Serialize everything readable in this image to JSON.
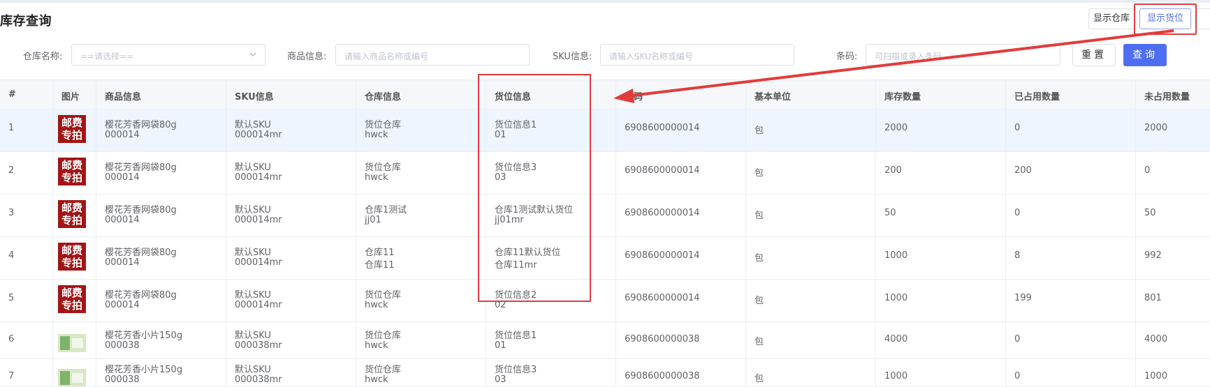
{
  "page": {
    "title": "库存查询"
  },
  "toolbar": {
    "show_warehouse": "显示仓库",
    "show_location": "显示货位",
    "edge_label": ""
  },
  "filters": {
    "warehouse": {
      "label": "仓库名称:",
      "placeholder": "==请选择=="
    },
    "product": {
      "label": "商品信息:",
      "placeholder": "请输入商品名称或编号"
    },
    "sku": {
      "label": "SKU信息:",
      "placeholder": "请输入SKU名称或编号"
    },
    "barcode": {
      "label": "条码:",
      "placeholder": "可扫描或录入条码"
    },
    "reset": "重置",
    "query": "查询"
  },
  "table": {
    "headers": [
      "#",
      "图片",
      "商品信息",
      "SKU信息",
      "仓库信息",
      "货位信息",
      "条码",
      "基本单位",
      "库存数量",
      "已占用数量",
      "未占用数量"
    ],
    "rows": [
      {
        "no": "1",
        "img": "邮费专拍",
        "product": "樱花芳香网袋80g",
        "product_code": "000014",
        "sku": "默认SKU",
        "sku_code": "000014mr",
        "wh": "货位仓库",
        "wh_code": "hwck",
        "loc": "货位信息1",
        "loc_code": "01",
        "barcode": "6908600000014",
        "unit": "包",
        "stock": "2000",
        "used": "0",
        "free": "2000"
      },
      {
        "no": "2",
        "img": "邮费专拍",
        "product": "樱花芳香网袋80g",
        "product_code": "000014",
        "sku": "默认SKU",
        "sku_code": "000014mr",
        "wh": "货位仓库",
        "wh_code": "hwck",
        "loc": "货位信息3",
        "loc_code": "03",
        "barcode": "6908600000014",
        "unit": "包",
        "stock": "200",
        "used": "200",
        "free": "0"
      },
      {
        "no": "3",
        "img": "邮费专拍",
        "product": "樱花芳香网袋80g",
        "product_code": "000014",
        "sku": "默认SKU",
        "sku_code": "000014mr",
        "wh": "仓库1测试",
        "wh_code": "jj01",
        "loc": "仓库1测试默认货位",
        "loc_code": "jj01mr",
        "barcode": "6908600000014",
        "unit": "包",
        "stock": "50",
        "used": "0",
        "free": "50"
      },
      {
        "no": "4",
        "img": "邮费专拍",
        "product": "樱花芳香网袋80g",
        "product_code": "000014",
        "sku": "默认SKU",
        "sku_code": "000014mr",
        "wh": "仓库11",
        "wh_code": "仓库11",
        "loc": "仓库11默认货位",
        "loc_code": "仓库11mr",
        "barcode": "6908600000014",
        "unit": "包",
        "stock": "1000",
        "used": "8",
        "free": "992"
      },
      {
        "no": "5",
        "img": "邮费专拍",
        "product": "樱花芳香网袋80g",
        "product_code": "000014",
        "sku": "默认SKU",
        "sku_code": "000014mr",
        "wh": "货位仓库",
        "wh_code": "hwck",
        "loc": "货位信息2",
        "loc_code": "02",
        "barcode": "6908600000014",
        "unit": "包",
        "stock": "1000",
        "used": "199",
        "free": "801"
      },
      {
        "no": "6",
        "img": "",
        "product": "樱花芳香小片150g",
        "product_code": "000038",
        "sku": "默认SKU",
        "sku_code": "000038mr",
        "wh": "货位仓库",
        "wh_code": "hwck",
        "loc": "货位信息1",
        "loc_code": "01",
        "barcode": "6908600000038",
        "unit": "包",
        "stock": "4000",
        "used": "0",
        "free": "4000"
      },
      {
        "no": "7",
        "img": "",
        "product": "樱花芳香小片150g",
        "product_code": "000038",
        "sku": "默认SKU",
        "sku_code": "000038mr",
        "wh": "货位仓库",
        "wh_code": "hwck",
        "loc": "货位信息3",
        "loc_code": "03",
        "barcode": "6908600000038",
        "unit": "包",
        "stock": "1000",
        "used": "0",
        "free": "1000"
      }
    ]
  },
  "colors": {
    "accent": "#4e6ef2",
    "highlight": "#e23b3b",
    "selected_row": "#eef5fe"
  }
}
